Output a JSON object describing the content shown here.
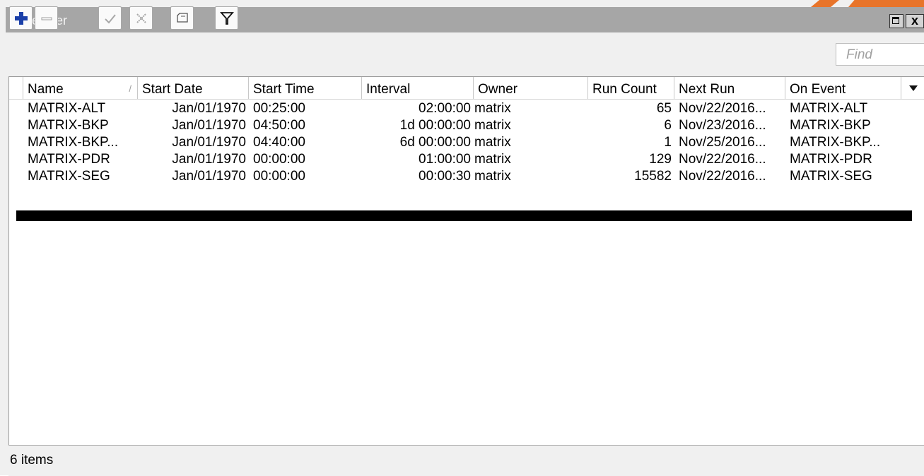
{
  "window": {
    "title": "Scheduler",
    "maximize_icon": "restore-box",
    "close_label": "x"
  },
  "toolbar": {
    "buttons": [
      {
        "name": "add-button",
        "icon": "plus-icon",
        "enabled": true
      },
      {
        "name": "remove-button",
        "icon": "minus-icon",
        "enabled": false
      },
      {
        "name": "enable-button",
        "icon": "check-icon",
        "enabled": false
      },
      {
        "name": "disable-button",
        "icon": "cross-icon",
        "enabled": false
      },
      {
        "name": "comment-button",
        "icon": "comment-icon",
        "enabled": true
      },
      {
        "name": "filter-button",
        "icon": "filter-icon",
        "enabled": true
      }
    ],
    "find_placeholder": "Find"
  },
  "table": {
    "columns": [
      {
        "label": "Name",
        "sorted": true
      },
      {
        "label": "Start Date"
      },
      {
        "label": "Start Time"
      },
      {
        "label": "Interval"
      },
      {
        "label": "Owner"
      },
      {
        "label": "Run Count"
      },
      {
        "label": "Next Run"
      },
      {
        "label": "On Event"
      }
    ],
    "sort_indicator": "/",
    "rows": [
      {
        "name": "MATRIX-ALT",
        "start_date": "Jan/01/1970",
        "start_time": "00:25:00",
        "interval": "02:00:00",
        "owner": "matrix",
        "run_count": "65",
        "next_run": "Nov/22/2016...",
        "on_event": "MATRIX-ALT"
      },
      {
        "name": "MATRIX-BKP",
        "start_date": "Jan/01/1970",
        "start_time": "04:50:00",
        "interval": "1d 00:00:00",
        "owner": "matrix",
        "run_count": "6",
        "next_run": "Nov/23/2016...",
        "on_event": "MATRIX-BKP"
      },
      {
        "name": "MATRIX-BKP...",
        "start_date": "Jan/01/1970",
        "start_time": "04:40:00",
        "interval": "6d 00:00:00",
        "owner": "matrix",
        "run_count": "1",
        "next_run": "Nov/25/2016...",
        "on_event": "MATRIX-BKP..."
      },
      {
        "name": "MATRIX-PDR",
        "start_date": "Jan/01/1970",
        "start_time": "00:00:00",
        "interval": "01:00:00",
        "owner": "matrix",
        "run_count": "129",
        "next_run": "Nov/22/2016...",
        "on_event": "MATRIX-PDR"
      },
      {
        "name": "MATRIX-SEG",
        "start_date": "Jan/01/1970",
        "start_time": "00:00:00",
        "interval": "00:00:30",
        "owner": "matrix",
        "run_count": "15582",
        "next_run": "Nov/22/2016...",
        "on_event": "MATRIX-SEG"
      }
    ],
    "redacted_row": true
  },
  "status": {
    "count_text": "6 items"
  },
  "colors": {
    "titlebar": "#a6a6a6",
    "accent_orange": "#e8742a",
    "plus_blue": "#1a3fa8"
  }
}
